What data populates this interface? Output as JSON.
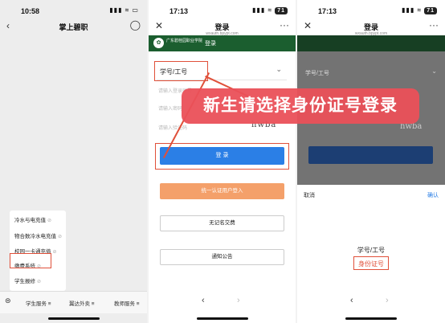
{
  "panel1": {
    "status": {
      "time": "10:58"
    },
    "nav": {
      "title": "掌上碧职"
    },
    "menu": [
      "冷水与电充值",
      "物合数冷水电充值",
      "校园一卡通充值",
      "缴费系统",
      "学生报修"
    ],
    "tabs": [
      "学生服务",
      "翼达外卖",
      "教师服务"
    ]
  },
  "panel2": {
    "status": {
      "time": "17:13",
      "battery": "71"
    },
    "nav": {
      "title": "登录",
      "subtitle": "wxauth.bpypt.com"
    },
    "banner": {
      "school": "广东碧桂园职业学院",
      "title": "登录"
    },
    "select_label": "学号/工号",
    "fields": [
      "请输入登录账号",
      "请输入密码",
      "请输入验证码"
    ],
    "captcha": "hwba",
    "login_label": "登 录",
    "unified_label": "统一认证用户登入",
    "anon_pay_label": "无记名交费",
    "notice_label": "通知公告"
  },
  "overlay": {
    "text": "新生请选择身份证号登录"
  },
  "panel3": {
    "status": {
      "time": "17:13",
      "battery": "71"
    },
    "nav": {
      "title": "登录",
      "subtitle": "wxauth.bpypt.com"
    },
    "dim_label": "学号/工号",
    "captcha": "hwba",
    "picker": {
      "cancel": "取消",
      "confirm": "确认",
      "options": [
        "学号/工号",
        "身份证号"
      ]
    }
  },
  "colors": {
    "highlight": "#e0503a",
    "login": "#2b7fe6",
    "banner": "#1b5e2f",
    "overlay": "#ea5058"
  }
}
